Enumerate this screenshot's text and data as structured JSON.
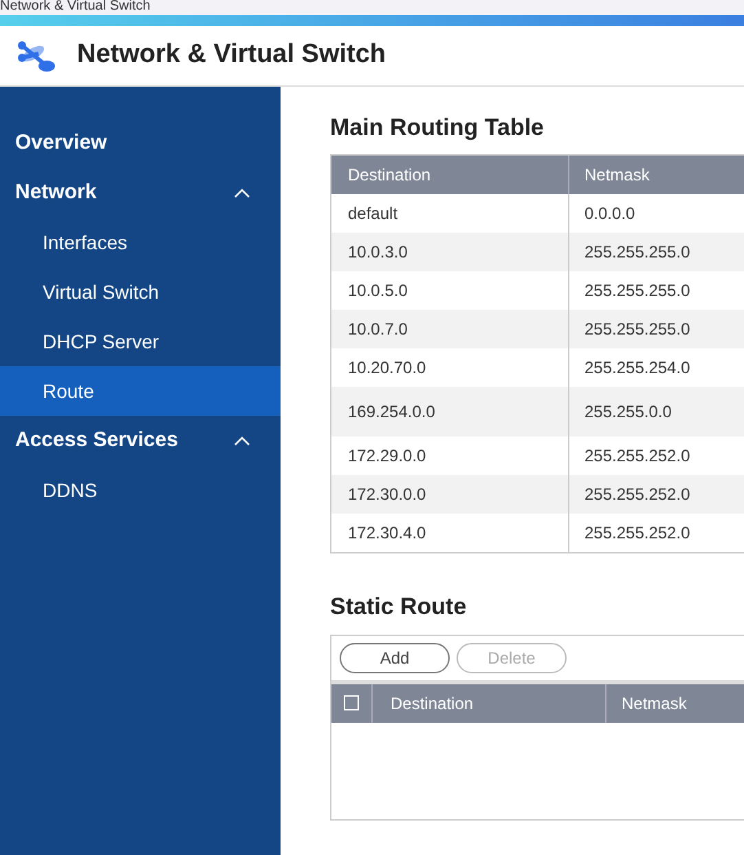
{
  "window": {
    "title": "Network & Virtual Switch"
  },
  "app": {
    "title": "Network & Virtual Switch"
  },
  "sidebar": {
    "items": [
      {
        "label": "Overview",
        "selected": false
      },
      {
        "label": "Network",
        "selected": false,
        "expanded": true,
        "children": [
          {
            "label": "Interfaces",
            "selected": false
          },
          {
            "label": "Virtual Switch",
            "selected": false
          },
          {
            "label": "DHCP Server",
            "selected": false
          },
          {
            "label": "Route",
            "selected": true
          }
        ]
      },
      {
        "label": "Access Services",
        "selected": false,
        "expanded": true,
        "children": [
          {
            "label": "DDNS",
            "selected": false
          }
        ]
      }
    ]
  },
  "main_routing_table": {
    "title": "Main Routing Table",
    "columns": [
      "Destination",
      "Netmask"
    ],
    "rows": [
      [
        "default",
        "0.0.0.0"
      ],
      [
        "10.0.3.0",
        "255.255.255.0"
      ],
      [
        "10.0.5.0",
        "255.255.255.0"
      ],
      [
        "10.0.7.0",
        "255.255.255.0"
      ],
      [
        "10.20.70.0",
        "255.255.254.0"
      ],
      [
        "169.254.0.0",
        "255.255.0.0"
      ],
      [
        "172.29.0.0",
        "255.255.252.0"
      ],
      [
        "172.30.0.0",
        "255.255.252.0"
      ],
      [
        "172.30.4.0",
        "255.255.252.0"
      ]
    ]
  },
  "static_route": {
    "title": "Static Route",
    "buttons": [
      {
        "label": "Add",
        "disabled": false
      },
      {
        "label": "Delete",
        "disabled": true
      }
    ],
    "select_all_checked": false,
    "columns": [
      "Destination",
      "Netmask"
    ]
  }
}
